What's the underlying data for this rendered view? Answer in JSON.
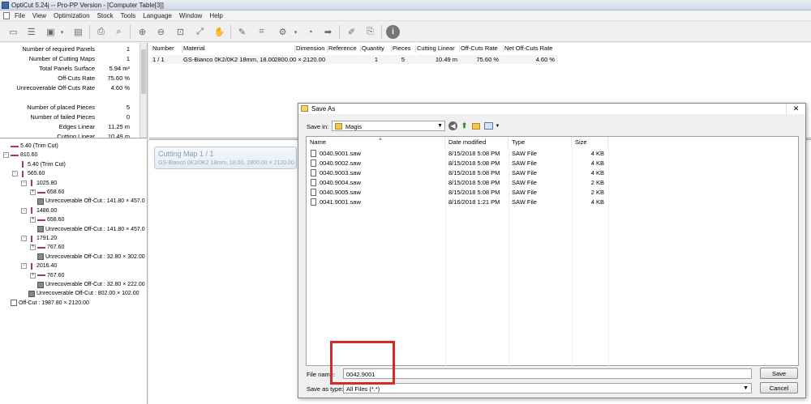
{
  "window": {
    "title": "OptiCut 5.24j -- Pro-PP Version - [Computer Table[3]]"
  },
  "menu": [
    "File",
    "View",
    "Optimization",
    "Stock",
    "Tools",
    "Language",
    "Window",
    "Help"
  ],
  "summary": [
    {
      "label": "Number of required Panels",
      "value": "1"
    },
    {
      "label": "Number of Cutting Maps",
      "value": "1"
    },
    {
      "label": "Total Panels Surface",
      "value": "5.94 m²"
    },
    {
      "label": "Off-Cuts Rate",
      "value": "75.60 %"
    },
    {
      "label": "Unrecoverable Off-Cuts Rate",
      "value": "4.60 %"
    },
    {
      "label": "",
      "value": ""
    },
    {
      "label": "Number of placed Pieces",
      "value": "5"
    },
    {
      "label": "Number of failed Pieces",
      "value": "0"
    },
    {
      "label": "Edges Linear",
      "value": "11.25 m"
    },
    {
      "label": "Cutting Linear",
      "value": "10.49 m"
    }
  ],
  "grid": {
    "headers": [
      "Number",
      "Material",
      "Dimension",
      "Reference",
      "Quantity",
      "Pieces",
      "Cutting Linear",
      "Off-Cuts Rate",
      "Net Off-Cuts Rate"
    ],
    "row": [
      "1 / 1",
      "GS-Bianco 0K2/0K2 18mm, 18.00",
      "2800.00 × 2120.00",
      "",
      "1",
      "5",
      "10.49 m",
      "75.60 %",
      "4.60 %"
    ]
  },
  "tree": [
    {
      "text": "5.40 (Trim Cut)",
      "kind": "h",
      "indent": 0,
      "exp": ""
    },
    {
      "text": "810.60",
      "kind": "h",
      "indent": 0,
      "exp": "-"
    },
    {
      "text": "5.40 (Trim Cut)",
      "kind": "v",
      "indent": 1,
      "exp": ""
    },
    {
      "text": "565.60",
      "kind": "v",
      "indent": 1,
      "exp": "-"
    },
    {
      "text": "1025.80",
      "kind": "v",
      "indent": 2,
      "exp": "-"
    },
    {
      "text": "658.60",
      "kind": "h",
      "indent": 3,
      "exp": "+"
    },
    {
      "text": "Unrecoverable Off-Cut : 141.80 × 457.0",
      "kind": "box",
      "indent": 3,
      "exp": ""
    },
    {
      "text": "1486.00",
      "kind": "v",
      "indent": 2,
      "exp": "-"
    },
    {
      "text": "658.60",
      "kind": "h",
      "indent": 3,
      "exp": "+"
    },
    {
      "text": "Unrecoverable Off-Cut : 141.80 × 457.0",
      "kind": "box",
      "indent": 3,
      "exp": ""
    },
    {
      "text": "1791.20",
      "kind": "v",
      "indent": 2,
      "exp": "-"
    },
    {
      "text": "767.60",
      "kind": "h",
      "indent": 3,
      "exp": "+"
    },
    {
      "text": "Unrecoverable Off-Cut : 32.80 × 302.00",
      "kind": "box",
      "indent": 3,
      "exp": ""
    },
    {
      "text": "2016.40",
      "kind": "v",
      "indent": 2,
      "exp": "-"
    },
    {
      "text": "767.60",
      "kind": "h",
      "indent": 3,
      "exp": "+"
    },
    {
      "text": "Unrecoverable Off-Cut : 32.80 × 222.00",
      "kind": "box",
      "indent": 3,
      "exp": ""
    },
    {
      "text": "Unrecoverable Off-Cut : 802.00 × 102.00",
      "kind": "box",
      "indent": 2,
      "exp": ""
    },
    {
      "text": "Off-Cut : 1987.80 × 2120.00",
      "kind": "boxlight",
      "indent": 0,
      "exp": ""
    }
  ],
  "cutting_map": {
    "title": "Cutting Map 1 / 1",
    "subtitle": "GS-Bianco 0K2/0K2 18mm, 18.00, 2800.00 × 2120.00"
  },
  "dialog": {
    "title": "Save As",
    "save_in_label": "Save in:",
    "save_in_value": "Magis",
    "columns": [
      "Name",
      "Date modified",
      "Type",
      "Size"
    ],
    "files": [
      {
        "name": "0040.9001.saw",
        "date": "8/15/2018 5:08 PM",
        "type": "SAW File",
        "size": "4 KB"
      },
      {
        "name": "0040.9002.saw",
        "date": "8/15/2018 5:08 PM",
        "type": "SAW File",
        "size": "4 KB"
      },
      {
        "name": "0040.9003.saw",
        "date": "8/15/2018 5:08 PM",
        "type": "SAW File",
        "size": "4 KB"
      },
      {
        "name": "0040.9004.saw",
        "date": "8/15/2018 5:08 PM",
        "type": "SAW File",
        "size": "2 KB"
      },
      {
        "name": "0040.9005.saw",
        "date": "8/15/2018 5:08 PM",
        "type": "SAW File",
        "size": "2 KB"
      },
      {
        "name": "0041.9001.saw",
        "date": "8/16/2018 1:21 PM",
        "type": "SAW File",
        "size": "4 KB"
      }
    ],
    "file_name_label": "File name:",
    "file_name_value": "0042.9001",
    "save_as_type_label": "Save as type:",
    "save_as_type_value": "All Files (*.*)",
    "save_label": "Save",
    "cancel_label": "Cancel",
    "close_glyph": "✕"
  },
  "colors": {
    "highlight": "#d42b2b",
    "cut_line": "#b0306a"
  }
}
